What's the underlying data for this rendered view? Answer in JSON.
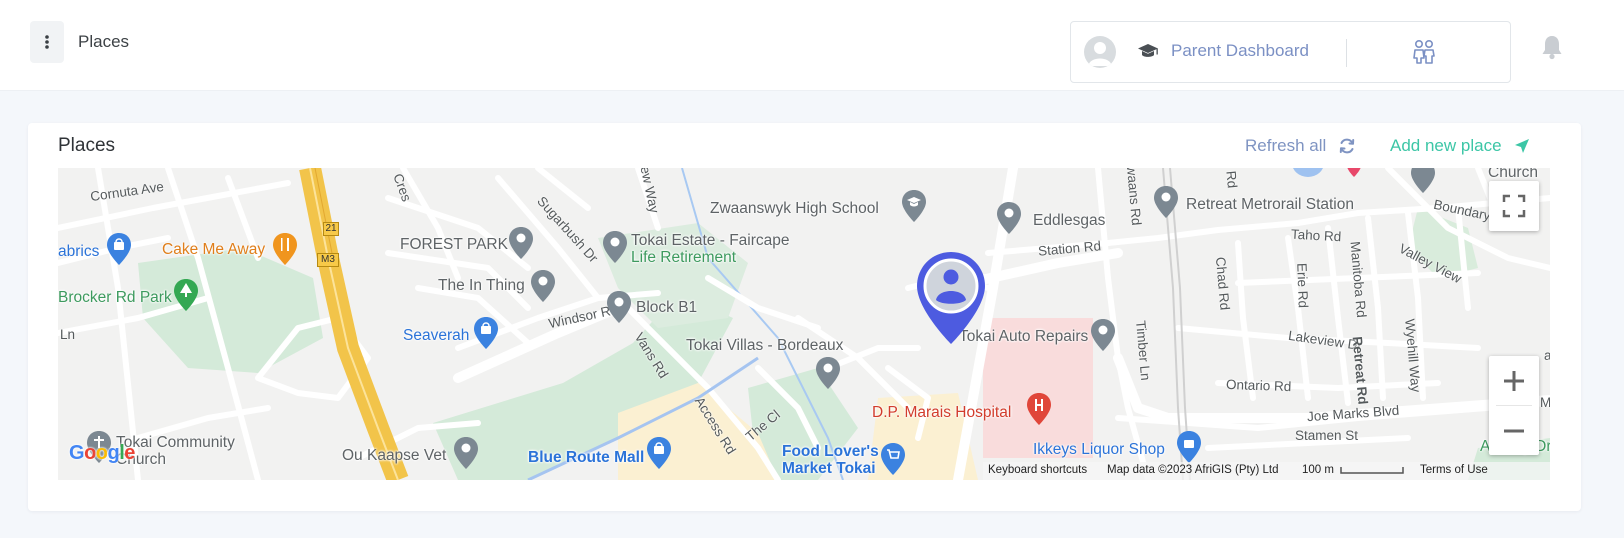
{
  "header": {
    "page_title": "Places",
    "dashboard_label": "Parent Dashboard"
  },
  "card": {
    "title": "Places",
    "refresh_label": "Refresh all",
    "add_label": "Add new place"
  },
  "colors": {
    "accent_blue": "#7b90c4",
    "accent_green": "#3cc6a6",
    "marker_blue": "#4d5be0"
  },
  "map": {
    "place_labels": {
      "zwaanswyk": "Zwaanswyk High School",
      "eddlesgas": "Eddlesgas",
      "retreat_station": "Retreat Metrorail Station",
      "church": "Church",
      "forest_park": "FOREST PARK",
      "tokai_estate_1": "Tokai Estate - Faircape",
      "tokai_estate_2": "Life Retirement",
      "cake": "Cake Me Away",
      "fabrics": "abrics",
      "in_thing": "The In Thing",
      "block_b1": "Block B1",
      "brocker": "Brocker Rd Park",
      "seaverah": "Seaverah",
      "tokai_villas": "Tokai Villas - Bordeaux",
      "auto_repairs": "Tokai Auto Repairs",
      "hospital": "D.P. Marais Hospital",
      "tokai_comm_1": "Tokai Community",
      "tokai_comm_2": "Church",
      "vet": "Ou Kaapse Vet",
      "blue_route": "Blue Route Mall",
      "food_lovers_1": "Food Lover's",
      "food_lovers_2": "Market Tokai",
      "ikkeys": "Ikkeys Liquor Shop",
      "allenby": "Allenby Dri"
    },
    "road_labels": {
      "cornuta": "Cornuta Ave",
      "cres": "Cres",
      "new_way": "ew Way",
      "sugarbush": "Sugarbush Dr",
      "ln": "Ln",
      "windsor": "Windsor Rd",
      "vans": "Vans Rd",
      "access": "Access Rd",
      "the_cl": "The Cl",
      "station": "Station Rd",
      "swaans": "waans Rd",
      "chad": "Chad Rd",
      "rd_top": "Rd",
      "taho": "Taho Rd",
      "erie": "Erie Rd",
      "manitoba": "Manitoba Rd",
      "boundary": "Boundary R",
      "valley": "Valley View",
      "timber": "Timber Ln",
      "lakeview": "Lakeview Dr",
      "retreat_rd": "Retreat Rd",
      "wyehill": "Wyehill Way",
      "ontario": "Ontario Rd",
      "joe_marks": "Joe Marks Blvd",
      "stamen": "Stamen St",
      "ar": "ar",
      "m": "M",
      "m3": "M3",
      "r21": "21"
    },
    "logo": "Google",
    "attribution": {
      "shortcuts": "Keyboard shortcuts",
      "map_data": "Map data ©2023 AfriGIS (Pty) Ltd",
      "scale": "100 m",
      "terms": "Terms of Use"
    }
  }
}
